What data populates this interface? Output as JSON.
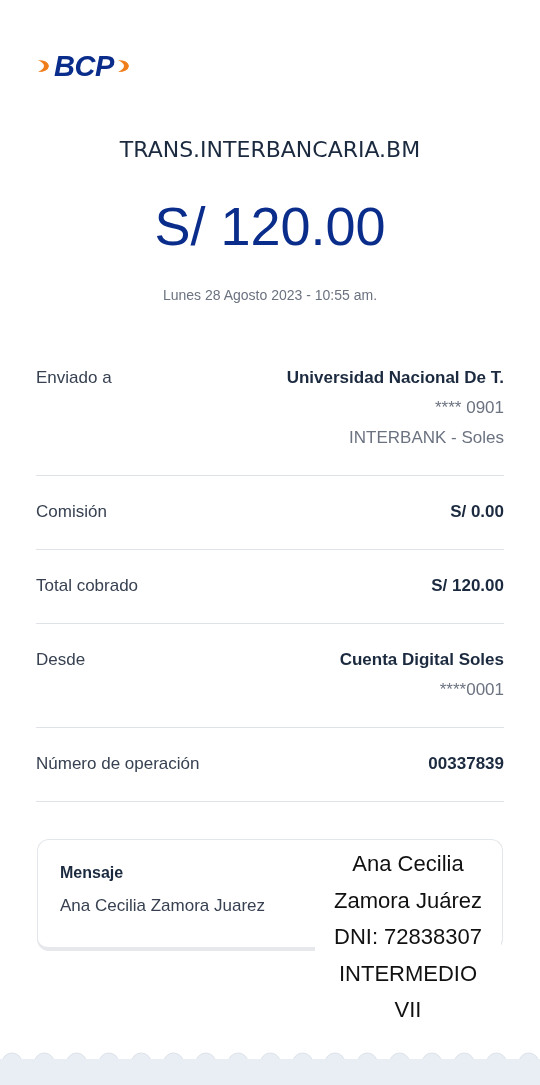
{
  "logo": {
    "text": "BCP"
  },
  "title": "TRANS.INTERBANCARIA.BM",
  "amount": "S/ 120.00",
  "date": "Lunes 28 Agosto 2023 - 10:55 am.",
  "details": [
    {
      "label": "Enviado a",
      "values": [
        "Universidad Nacional De T.",
        "**** 0901",
        "INTERBANK - Soles"
      ]
    },
    {
      "label": "Comisión",
      "values": [
        "S/ 0.00"
      ]
    },
    {
      "label": "Total cobrado",
      "values": [
        "S/ 120.00"
      ]
    },
    {
      "label": "Desde",
      "values": [
        "Cuenta Digital Soles",
        "****0001"
      ]
    },
    {
      "label": "Número de operación",
      "values": [
        "00337839"
      ]
    }
  ],
  "message": {
    "label": "Mensaje",
    "text": "Ana Cecilia Zamora Juarez"
  },
  "overlay_note": [
    "Ana Cecilia",
    "Zamora Juárez",
    "DNI: 72838307",
    "INTERMEDIO",
    "VII"
  ]
}
